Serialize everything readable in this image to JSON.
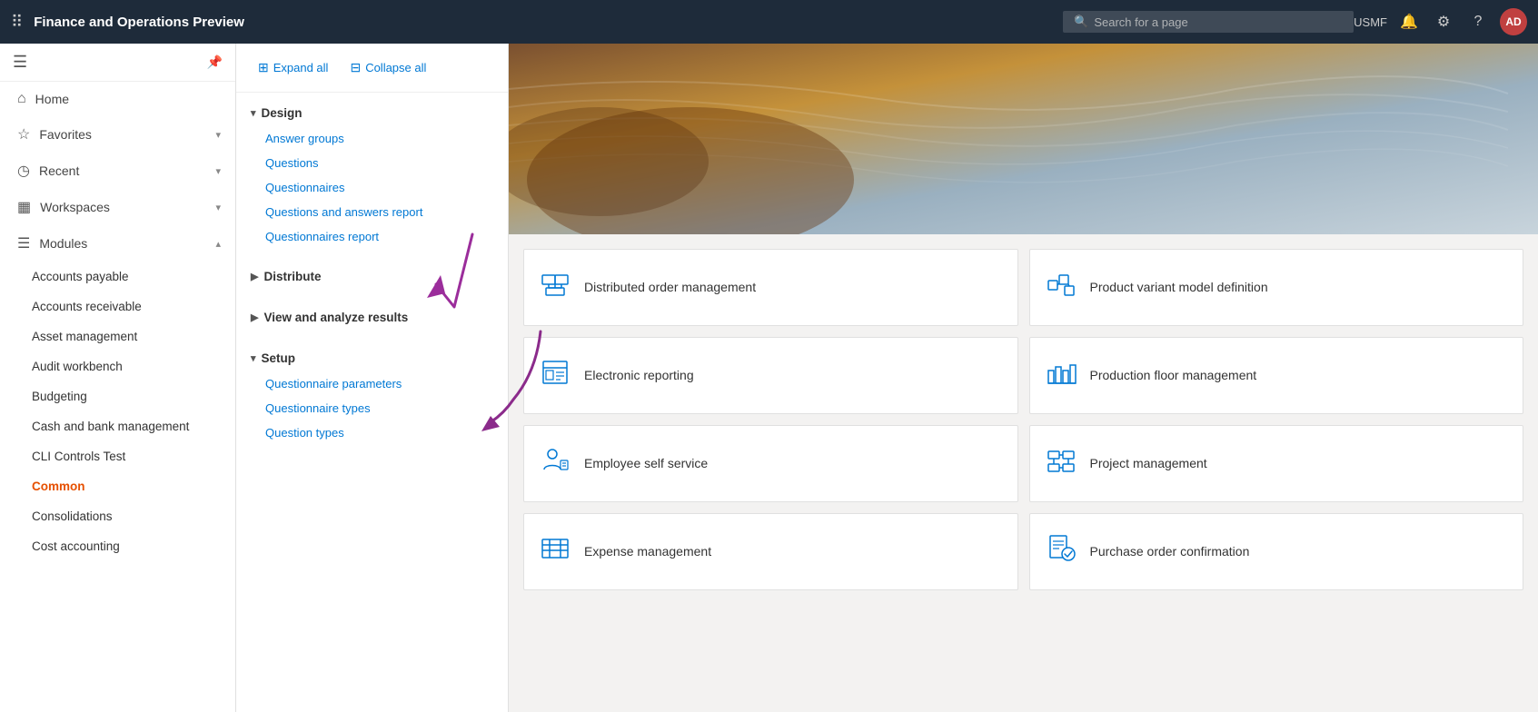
{
  "app": {
    "title": "Finance and Operations Preview"
  },
  "topnav": {
    "search_placeholder": "Search for a page",
    "company": "USMF",
    "avatar_initials": "AD"
  },
  "sidebar": {
    "nav_items": [
      {
        "id": "home",
        "label": "Home",
        "icon": "⌂"
      },
      {
        "id": "favorites",
        "label": "Favorites",
        "icon": "☆",
        "has_chevron": true
      },
      {
        "id": "recent",
        "label": "Recent",
        "icon": "◷",
        "has_chevron": true
      },
      {
        "id": "workspaces",
        "label": "Workspaces",
        "icon": "▦",
        "has_chevron": true
      },
      {
        "id": "modules",
        "label": "Modules",
        "icon": "☰",
        "has_chevron": true,
        "expanded": true
      }
    ],
    "modules": [
      {
        "label": "Accounts payable",
        "bold": false
      },
      {
        "label": "Accounts receivable",
        "bold": false
      },
      {
        "label": "Asset management",
        "bold": false
      },
      {
        "label": "Audit workbench",
        "bold": false
      },
      {
        "label": "Budgeting",
        "bold": false
      },
      {
        "label": "Cash and bank management",
        "bold": false
      },
      {
        "label": "CLI Controls Test",
        "bold": false
      },
      {
        "label": "Common",
        "bold": true
      },
      {
        "label": "Consolidations",
        "bold": false
      },
      {
        "label": "Cost accounting",
        "bold": false
      }
    ]
  },
  "center": {
    "expand_all": "Expand all",
    "collapse_all": "Collapse all",
    "sections": [
      {
        "id": "design",
        "label": "Design",
        "expanded": true,
        "items": [
          "Answer groups",
          "Questions",
          "Questionnaires",
          "Questions and answers report",
          "Questionnaires report"
        ]
      },
      {
        "id": "distribute",
        "label": "Distribute",
        "expanded": false,
        "items": []
      },
      {
        "id": "view-analyze",
        "label": "View and analyze results",
        "expanded": false,
        "items": []
      },
      {
        "id": "setup",
        "label": "Setup",
        "expanded": true,
        "items": [
          "Questionnaire parameters",
          "Questionnaire types",
          "Question types"
        ]
      }
    ]
  },
  "tiles": [
    {
      "id": "distributed-order",
      "label": "Distributed order management",
      "icon": "distributed"
    },
    {
      "id": "product-variant",
      "label": "Product variant model definition",
      "icon": "product-variant"
    },
    {
      "id": "electronic-reporting",
      "label": "Electronic reporting",
      "icon": "electronic-reporting"
    },
    {
      "id": "production-floor",
      "label": "Production floor management",
      "icon": "production-floor"
    },
    {
      "id": "employee-self-service",
      "label": "Employee self service",
      "icon": "employee"
    },
    {
      "id": "project-management",
      "label": "Project management",
      "icon": "project"
    },
    {
      "id": "expense-management",
      "label": "Expense management",
      "icon": "expense"
    },
    {
      "id": "purchase-order-confirmation",
      "label": "Purchase order confirmation",
      "icon": "purchase-order"
    }
  ]
}
